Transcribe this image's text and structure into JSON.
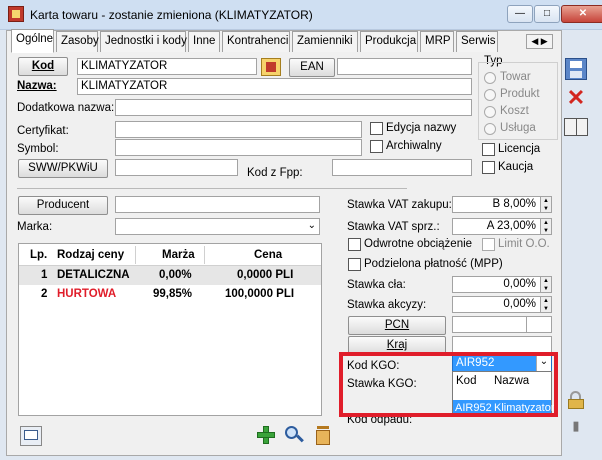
{
  "window": {
    "title": "Karta towaru - zostanie zmieniona (KLIMATYZATOR)"
  },
  "tabs": [
    "Ogólne",
    "Zasoby",
    "Jednostki i kody",
    "Inne",
    "Kontrahenci",
    "Zamienniki",
    "Produkcja",
    "MRP",
    "Serwis"
  ],
  "form": {
    "kod_label": "Kod",
    "kod_value": "KLIMATYZATOR",
    "ean_button": "EAN",
    "nazwa_label": "Nazwa:",
    "nazwa_value": "KLIMATYZATOR",
    "dodatkowa_label": "Dodatkowa nazwa:",
    "certyfikat_label": "Certyfikat:",
    "symbol_label": "Symbol:",
    "sww_button": "SWW/PKWiU",
    "kod_fpp_label": "Kod z Fpp:",
    "edycja_nazwy": "Edycja nazwy",
    "archiwalny": "Archiwalny",
    "licencja": "Licencja",
    "kaucja": "Kaucja",
    "producent_button": "Producent",
    "marka_label": "Marka:"
  },
  "typ": {
    "label": "Typ",
    "options": [
      "Towar",
      "Produkt",
      "Koszt",
      "Usługa"
    ]
  },
  "prices": {
    "headers": [
      "Lp.",
      "Rodzaj ceny",
      "Marża",
      "Cena"
    ],
    "rows": [
      {
        "lp": "1",
        "rodzaj": "DETALICZNA",
        "marza": "0,00%",
        "cena": "0,0000 PLI",
        "color": "#000000"
      },
      {
        "lp": "2",
        "rodzaj": "HURTOWA",
        "marza": "99,85%",
        "cena": "100,0000 PLI",
        "color": "#e01d2a"
      }
    ]
  },
  "vat": {
    "zakupu_label": "Stawka VAT zakupu:",
    "zakupu_value": "B 8,00%",
    "sprz_label": "Stawka VAT sprz.:",
    "sprz_value": "A 23,00%",
    "odwrotne": "Odwrotne obciążenie",
    "limit": "Limit O.O.",
    "podzielona": "Podzielona płatność (MPP)",
    "cla_label": "Stawka cła:",
    "cla_value": "0,00%",
    "akcyzy_label": "Stawka akcyzy:",
    "akcyzy_value": "0,00%",
    "pcn_button": "PCN",
    "kraj_button": "Kraj",
    "kod_kgo_label": "Kod KGO:",
    "kod_kgo_value": "AIR952",
    "stawka_kgo_label": "Stawka KGO:",
    "kod_odpadu_label": "Kod odpadu:"
  },
  "kgo_dropdown": {
    "col_kod": "Kod",
    "col_nazwa": "Nazwa",
    "item_kod": "AIR952",
    "item_nazwa": "Klimatyzator"
  },
  "colors": {
    "accent": "#e01d2a",
    "selection": "#3399ff"
  }
}
